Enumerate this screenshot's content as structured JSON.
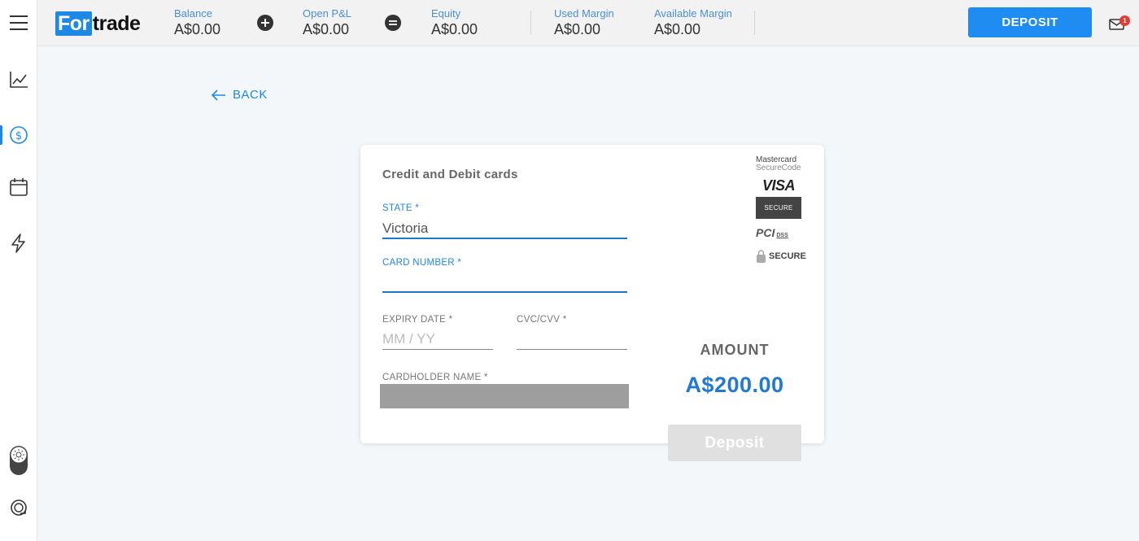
{
  "brand": {
    "logo_box": "For",
    "logo_rest": "trade"
  },
  "stats": [
    {
      "label": "Balance",
      "value": "A$0.00"
    },
    {
      "label": "Open P&L",
      "value": "A$0.00"
    },
    {
      "label": "Equity",
      "value": "A$0.00"
    },
    {
      "label": "Used Margin",
      "value": "A$0.00"
    },
    {
      "label": "Available Margin",
      "value": "A$0.00"
    }
  ],
  "header": {
    "deposit_label": "DEPOSIT",
    "notification_count": "1"
  },
  "nav": {
    "back_label": "BACK"
  },
  "card": {
    "title": "Credit and Debit cards",
    "state": {
      "label": "STATE *",
      "value": "Victoria"
    },
    "card_number": {
      "label": "CARD NUMBER *",
      "value": ""
    },
    "expiry": {
      "label": "EXPIRY DATE *",
      "placeholder": "MM / YY"
    },
    "cvc": {
      "label": "CVC/CVV *",
      "value": ""
    },
    "cardholder": {
      "label": "CARDHOLDER NAME *"
    },
    "amount_label": "AMOUNT",
    "amount_value": "A$200.00",
    "deposit_label": "Deposit"
  },
  "security": {
    "mastercard_line1": "Mastercard",
    "mastercard_line2": "SecureCode",
    "visa": "VISA",
    "visa_secure": "SECURE",
    "pci": "PCI",
    "pci_dss": "DSS",
    "ssl": "SECURE"
  },
  "colors": {
    "accent": "#1e88e5",
    "amount": "#2178d6",
    "disabled_button": "#e0e0e0"
  }
}
